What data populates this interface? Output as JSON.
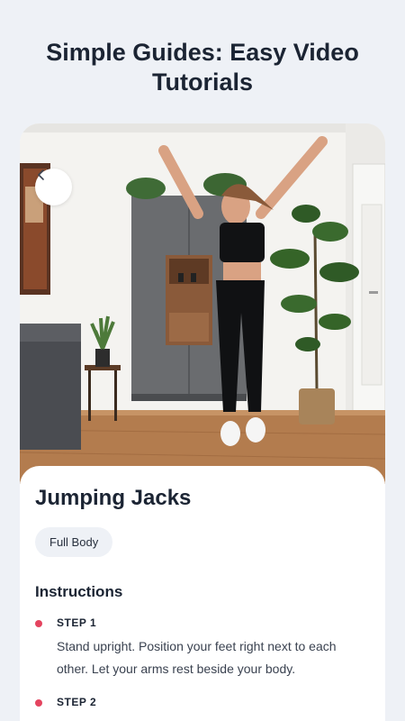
{
  "headline": "Simple Guides: Easy Video Tutorials",
  "video": {
    "back_icon": "chevron-left-icon"
  },
  "exercise": {
    "title": "Jumping Jacks",
    "tag": "Full Body",
    "instructions_label": "Instructions",
    "steps": [
      {
        "label": "STEP 1",
        "text": "Stand upright. Position your feet right next to each other. Let your arms rest beside your body."
      },
      {
        "label": "STEP 2",
        "text": ""
      }
    ]
  },
  "colors": {
    "accent": "#e4445f",
    "background": "#eef1f6",
    "chip": "#eef1f6"
  }
}
